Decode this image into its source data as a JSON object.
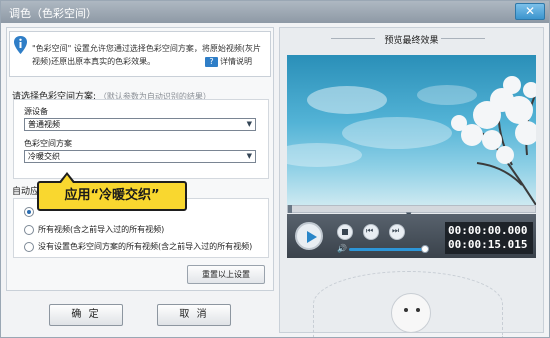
{
  "window": {
    "title": "调色（色彩空间）",
    "close_label": "✕"
  },
  "info": {
    "text": "\"色彩空间\" 设置允许您通过选择色彩空间方案，将原始视频(灰片视频)还原出原本真实的色彩效果。",
    "help_label": "详情说明",
    "help_icon": "help-icon"
  },
  "scheme": {
    "section_title": "请选择色彩空间方案:",
    "section_hint": "（默认参数为自动识别的结果）",
    "source_label": "源设备",
    "source_value": "普通视频",
    "colorspace_label": "色彩空间方案",
    "colorspace_value": "冷暖交织"
  },
  "auto": {
    "label": "自动应",
    "options": [
      {
        "label": "",
        "checked": true
      },
      {
        "label": "所有视频(含之前导入过的所有视频)",
        "checked": false
      },
      {
        "label": "没有设置色彩空间方案的所有视频(含之前导入过的所有视频)",
        "checked": false
      }
    ]
  },
  "buttons": {
    "reset": "重置以上设置",
    "ok": "确 定",
    "cancel": "取 消"
  },
  "callout": {
    "text": "应用“冷暖交织”"
  },
  "preview": {
    "title": "预览最终效果",
    "current_time": "00:00:00.000",
    "total_time": "00:00:15.015"
  },
  "colors": {
    "accent": "#2d96d8",
    "callout": "#f9d72f"
  }
}
